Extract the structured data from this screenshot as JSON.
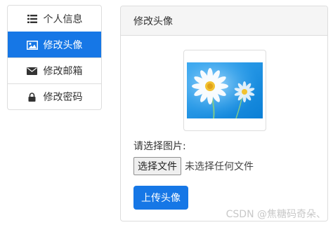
{
  "sidebar": {
    "items": [
      {
        "label": "个人信息",
        "icon": "list-icon",
        "active": false
      },
      {
        "label": "修改头像",
        "icon": "picture-icon",
        "active": true
      },
      {
        "label": "修改邮箱",
        "icon": "envelope-icon",
        "active": false
      },
      {
        "label": "修改密码",
        "icon": "lock-icon",
        "active": false
      }
    ]
  },
  "panel": {
    "title": "修改头像",
    "choose_label": "请选择图片:",
    "file_button_label": "选择文件",
    "file_status": "未选择任何文件",
    "upload_label": "上传头像"
  },
  "watermark": "CSDN @焦糖码奇朵、",
  "colors": {
    "accent": "#1677e6",
    "border": "#dddddd",
    "heading_bg": "#f5f5f5"
  }
}
